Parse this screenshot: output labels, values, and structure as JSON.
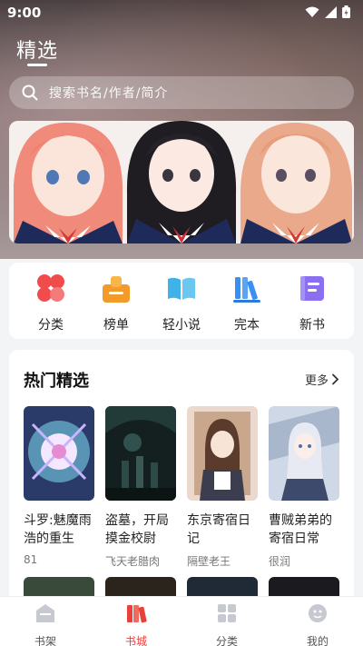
{
  "status_bar": {
    "time": "9:00"
  },
  "header": {
    "title": "精选"
  },
  "search": {
    "placeholder": "搜索书名/作者/简介"
  },
  "categories": [
    {
      "label": "分类",
      "icon": "clover-icon",
      "color": "#f24b4b"
    },
    {
      "label": "榜单",
      "icon": "ranking-icon",
      "color": "#f39a2a"
    },
    {
      "label": "轻小说",
      "icon": "open-book-icon",
      "color": "#3fb3e8"
    },
    {
      "label": "完本",
      "icon": "bookshelf-icon",
      "color": "#3b8ff0"
    },
    {
      "label": "新书",
      "icon": "new-book-icon",
      "color": "#8a6ff0"
    }
  ],
  "hot": {
    "title": "热门精选",
    "more_label": "更多",
    "books": [
      {
        "title": "斗罗:魅魔雨浩的重生",
        "author": "81"
      },
      {
        "title": "盗墓，开局摸金校尉",
        "author": "飞天老腊肉"
      },
      {
        "title": "东京寄宿日记",
        "author": "隔壁老王"
      },
      {
        "title": "曹贼弟弟的寄宿日常",
        "author": "很润"
      }
    ]
  },
  "tabbar": {
    "items": [
      {
        "label": "书架",
        "icon": "bookshelf-tab-icon"
      },
      {
        "label": "书城",
        "icon": "bookstore-tab-icon",
        "active": true
      },
      {
        "label": "分类",
        "icon": "category-tab-icon"
      },
      {
        "label": "我的",
        "icon": "profile-tab-icon"
      }
    ]
  },
  "colors": {
    "accent": "#e8413b",
    "background": "#f3f4f6"
  }
}
